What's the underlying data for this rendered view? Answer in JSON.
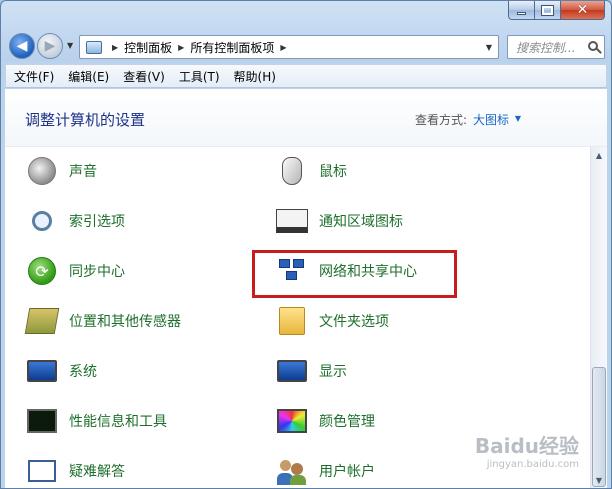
{
  "window": {
    "caption": {
      "minimize": "–",
      "maximize": "□",
      "close": "✕"
    }
  },
  "address": {
    "crumbs": [
      "控制面板",
      "所有控制面板项"
    ]
  },
  "search": {
    "placeholder": "搜索控制..."
  },
  "menu": [
    "文件(F)",
    "编辑(E)",
    "查看(V)",
    "工具(T)",
    "帮助(H)"
  ],
  "header": {
    "title": "调整计算机的设置",
    "view_by_label": "查看方式:",
    "view_by_value": "大图标"
  },
  "items": {
    "left": [
      "声音",
      "索引选项",
      "同步中心",
      "位置和其他传感器",
      "系统",
      "性能信息和工具",
      "疑难解答"
    ],
    "right": [
      "鼠标",
      "通知区域图标",
      "网络和共享中心",
      "文件夹选项",
      "显示",
      "颜色管理",
      "用户帐户"
    ]
  },
  "highlighted_item": "网络和共享中心",
  "watermark": {
    "main": "Baidu经验",
    "sub": "jingyan.baidu.com"
  },
  "colors": {
    "item_label": "#1e6f2c",
    "title": "#1e3287",
    "highlight_border": "#c91d1d",
    "link": "#1a66c4"
  }
}
